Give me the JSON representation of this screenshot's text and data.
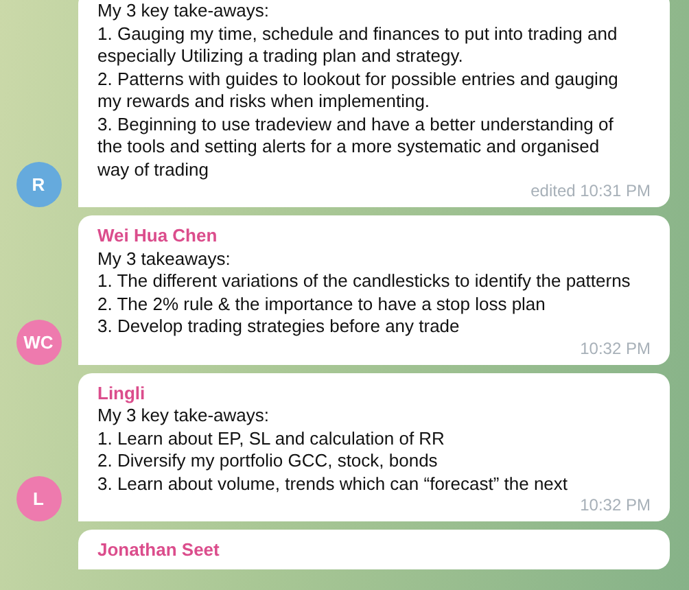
{
  "messages": [
    {
      "avatar": {
        "initials": "R",
        "color": "#65aadd"
      },
      "lines": [
        "My 3 key take-aways:",
        "1. Gauging my time, schedule and finances to put into trading and especially Utilizing a trading plan and strategy.",
        "2. Patterns with guides to lookout for possible entries and gauging my rewards and risks when implementing.",
        "3. Beginning to use tradeview and have a better understanding of the tools and setting alerts for a more systematic and organised way of trading"
      ],
      "time": "edited 10:31 PM"
    },
    {
      "sender": "Wei Hua Chen",
      "avatar": {
        "initials": "WC",
        "color": "#ee7aae"
      },
      "lines": [
        "My 3 takeaways:",
        "1. The different variations of the candlesticks to identify the patterns",
        "2. The 2% rule & the importance to have a stop loss plan",
        "3. Develop trading strategies before any trade"
      ],
      "time": "10:32 PM"
    },
    {
      "sender": "Lingli",
      "avatar": {
        "initials": "L",
        "color": "#ee7aae"
      },
      "lines": [
        "My 3 key take-aways:",
        "1. Learn about EP, SL and calculation of RR",
        "2. Diversify my portfolio GCC, stock, bonds",
        "3. Learn about volume, trends which can “forecast” the next"
      ],
      "time": "10:32 PM"
    },
    {
      "sender": "Jonathan Seet"
    }
  ]
}
